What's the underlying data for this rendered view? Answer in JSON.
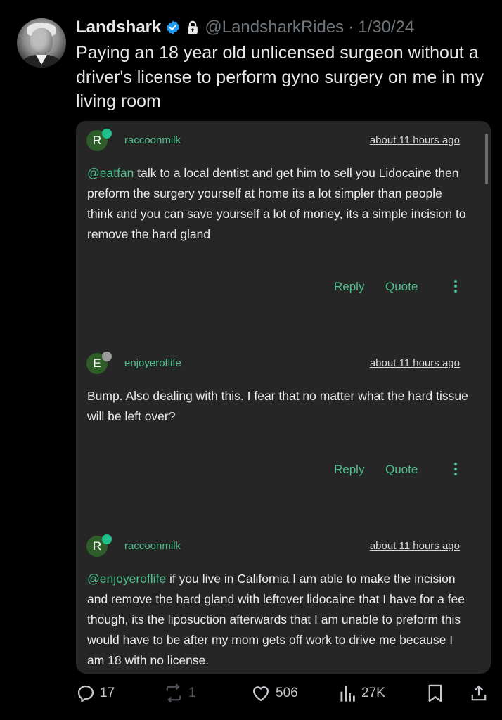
{
  "post": {
    "display_name": "Landshark",
    "handle": "@LandsharkRides",
    "separator": "·",
    "date": "1/30/24",
    "text": "Paying an 18 year old unlicensed surgeon without a driver's license to perform gyno surgery on me in my living room",
    "avatar_icon": "profile-photo"
  },
  "embedded_thread": {
    "comments": [
      {
        "avatar_letter": "R",
        "status_color": "#1fc08a",
        "username": "raccoonmilk",
        "time": "about 11 hours ago",
        "mention": "@eatfan",
        "text": " talk to a local dentist and get him to sell you Lidocaine then preform the surgery yourself at home its a lot simpler than people think and you can save yourself a lot of money, its a simple incision to remove the hard gland",
        "reply_label": "Reply",
        "quote_label": "Quote"
      },
      {
        "avatar_letter": "E",
        "status_color": "#9a9a9a",
        "username": "enjoyeroflife",
        "time": "about 11 hours ago",
        "mention": "",
        "text": "Bump. Also dealing with this. I fear that no matter what the hard tissue will be left over?",
        "reply_label": "Reply",
        "quote_label": "Quote"
      },
      {
        "avatar_letter": "R",
        "status_color": "#1fc08a",
        "username": "raccoonmilk",
        "time": "about 11 hours ago",
        "mention": "@enjoyeroflife",
        "text": " if you live in California I am able to make the incision and remove the hard gland with leftover lidocaine that I have for a fee though, its the liposuction afterwards that I am unable to preform this would have to be after my mom gets off work to drive me because I am 18 with no license."
      }
    ]
  },
  "actions": {
    "replies": "17",
    "reposts": "1",
    "likes": "506",
    "views": "27K"
  },
  "colors": {
    "background": "#000000",
    "embed_background": "#262626",
    "link_green": "#4fbf8e",
    "verified_blue": "#1d9bf0",
    "muted_text": "#71767b"
  }
}
